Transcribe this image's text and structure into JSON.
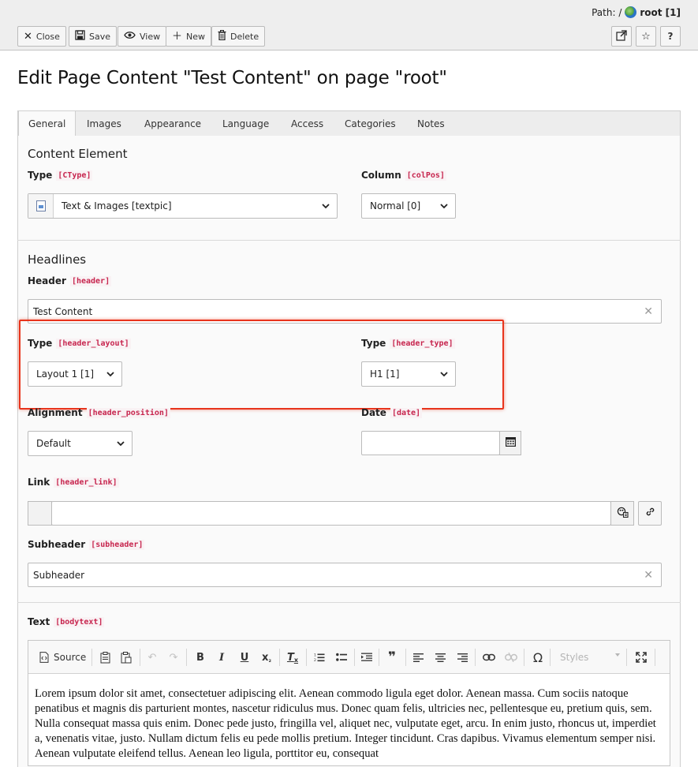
{
  "header": {
    "path_label": "Path: /",
    "path_root": "root [1]",
    "buttons": {
      "close": "Close",
      "save": "Save",
      "view": "View",
      "new": "New",
      "delete": "Delete",
      "help": "?"
    }
  },
  "title": "Edit Page Content \"Test Content\" on page \"root\"",
  "tabs": [
    "General",
    "Images",
    "Appearance",
    "Language",
    "Access",
    "Categories",
    "Notes"
  ],
  "active_tab": "General",
  "content_element": {
    "section_title": "Content Element",
    "type_label": "Type",
    "type_field": "[CType]",
    "type_value": "Text & Images [textpic]",
    "column_label": "Column",
    "column_field": "[colPos]",
    "column_value": "Normal [0]"
  },
  "headlines": {
    "section_title": "Headlines",
    "header_label": "Header",
    "header_field": "[header]",
    "header_value": "Test Content",
    "layout_label": "Type",
    "layout_field": "[header_layout]",
    "layout_value": "Layout 1 [1]",
    "htype_label": "Type",
    "htype_field": "[header_type]",
    "htype_value": "H1 [1]",
    "alignment_label": "Alignment",
    "alignment_field": "[header_position]",
    "alignment_value": "Default",
    "date_label": "Date",
    "date_field": "[date]",
    "date_value": "",
    "link_label": "Link",
    "link_field": "[header_link]",
    "link_value": "",
    "subheader_label": "Subheader",
    "subheader_field": "[subheader]",
    "subheader_value": "Subheader"
  },
  "text": {
    "label": "Text",
    "field": "[bodytext]",
    "toolbar": {
      "source": "Source",
      "styles": "Styles"
    },
    "body": "Lorem ipsum dolor sit amet, consectetuer adipiscing elit. Aenean commodo ligula eget dolor. Aenean massa. Cum sociis natoque penatibus et magnis dis parturient montes, nascetur ridiculus mus. Donec quam felis, ultricies nec, pellentesque eu, pretium quis, sem. Nulla consequat massa quis enim. Donec pede justo, fringilla vel, aliquet nec, vulputate eget, arcu. In enim justo, rhoncus ut, imperdiet a, venenatis vitae, justo. Nullam dictum felis eu pede mollis pretium. Integer tincidunt. Cras dapibus. Vivamus elementum semper nisi. Aenean vulputate eleifend tellus. Aenean leo ligula, porttitor eu, consequat"
  },
  "colors": {
    "highlight": "#e8341c",
    "field_code": "#c7254e"
  }
}
